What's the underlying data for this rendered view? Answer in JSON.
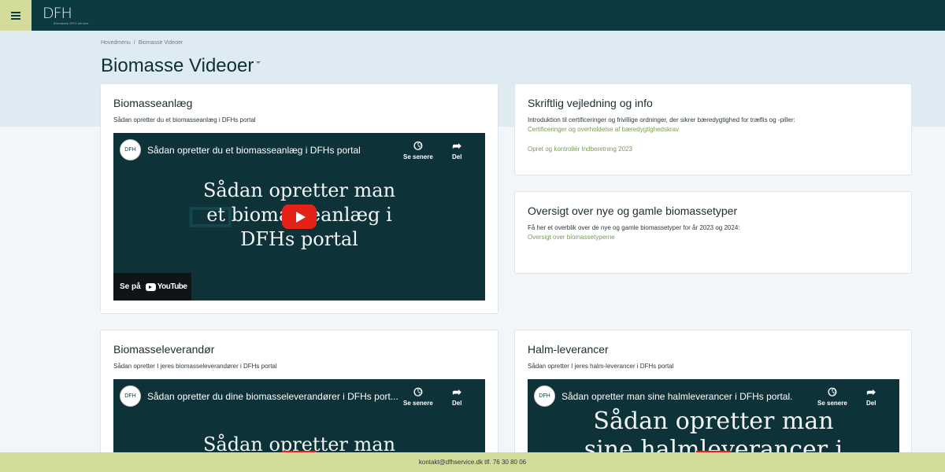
{
  "header": {
    "menu_icon": "hamburger-icon",
    "logo_text": "DFH",
    "logo_sub": "Biomasse  DFH service"
  },
  "breadcrumb": {
    "items": [
      "Hovedmenu",
      "Biomasse Videoer"
    ],
    "separator": "/"
  },
  "page": {
    "title": "Biomasse Videoer"
  },
  "cards": {
    "anlaeg": {
      "title": "Biomasseanlæg",
      "description": "Sådan opretter du et biomasseanlæg i DFHs portal",
      "video": {
        "title": "Sådan opretter du et biomasseanlæg i DFHs portal",
        "overlay_lines": [
          "Sådan opretter man",
          "et biomasseanlæg i",
          "DFHs portal"
        ],
        "watch_later": "Se senere",
        "share": "Del",
        "watch_on": "Se på",
        "youtube": "YouTube"
      }
    },
    "vejledning": {
      "title": "Skriftlig vejledning og info",
      "description": "Introduktion til certificeringer og frivillige ordninger, der sikrer bæredygtighed for træflis og -piller:",
      "links": [
        "Certificeringer og overholdelse af bæredygtighedskrav",
        "Opret og kontrollér Indberetning 2023"
      ]
    },
    "oversigt": {
      "title": "Oversigt over nye og gamle biomassetyper",
      "description": "Få her et overblik over de nye og gamle biomassetyper for år 2023 og 2024:",
      "link": "Oversigt over biomassetyperne"
    },
    "leverandoer": {
      "title": "Biomasseleverandør",
      "description": "Sådan opretter I jeres biomasseleverandører i DFHs portal",
      "video": {
        "title": "Sådan opretter du dine biomasseleverandører i DFHs port...",
        "overlay_lines": [
          "Sådan opretter man"
        ],
        "watch_later": "Se senere",
        "share": "Del"
      }
    },
    "halm": {
      "title": "Halm-leverancer",
      "description": "Sådan opretter I jeres halm-leverancer i DFHs portal",
      "video": {
        "title": "Sådan opretter man sine halmleverancer i DFHs portal.",
        "overlay_lines": [
          "Sådan opretter man",
          "sine halmleverancer i"
        ],
        "watch_later": "Se senere",
        "share": "Del"
      }
    }
  },
  "footer": {
    "text": "kontakt@dfhservice.dk tlf. 76 30 80 06"
  },
  "colors": {
    "topbar": "#0b3a40",
    "accent": "#d3dc9a",
    "link": "#7b9a56",
    "youtube_red": "#e62117"
  }
}
